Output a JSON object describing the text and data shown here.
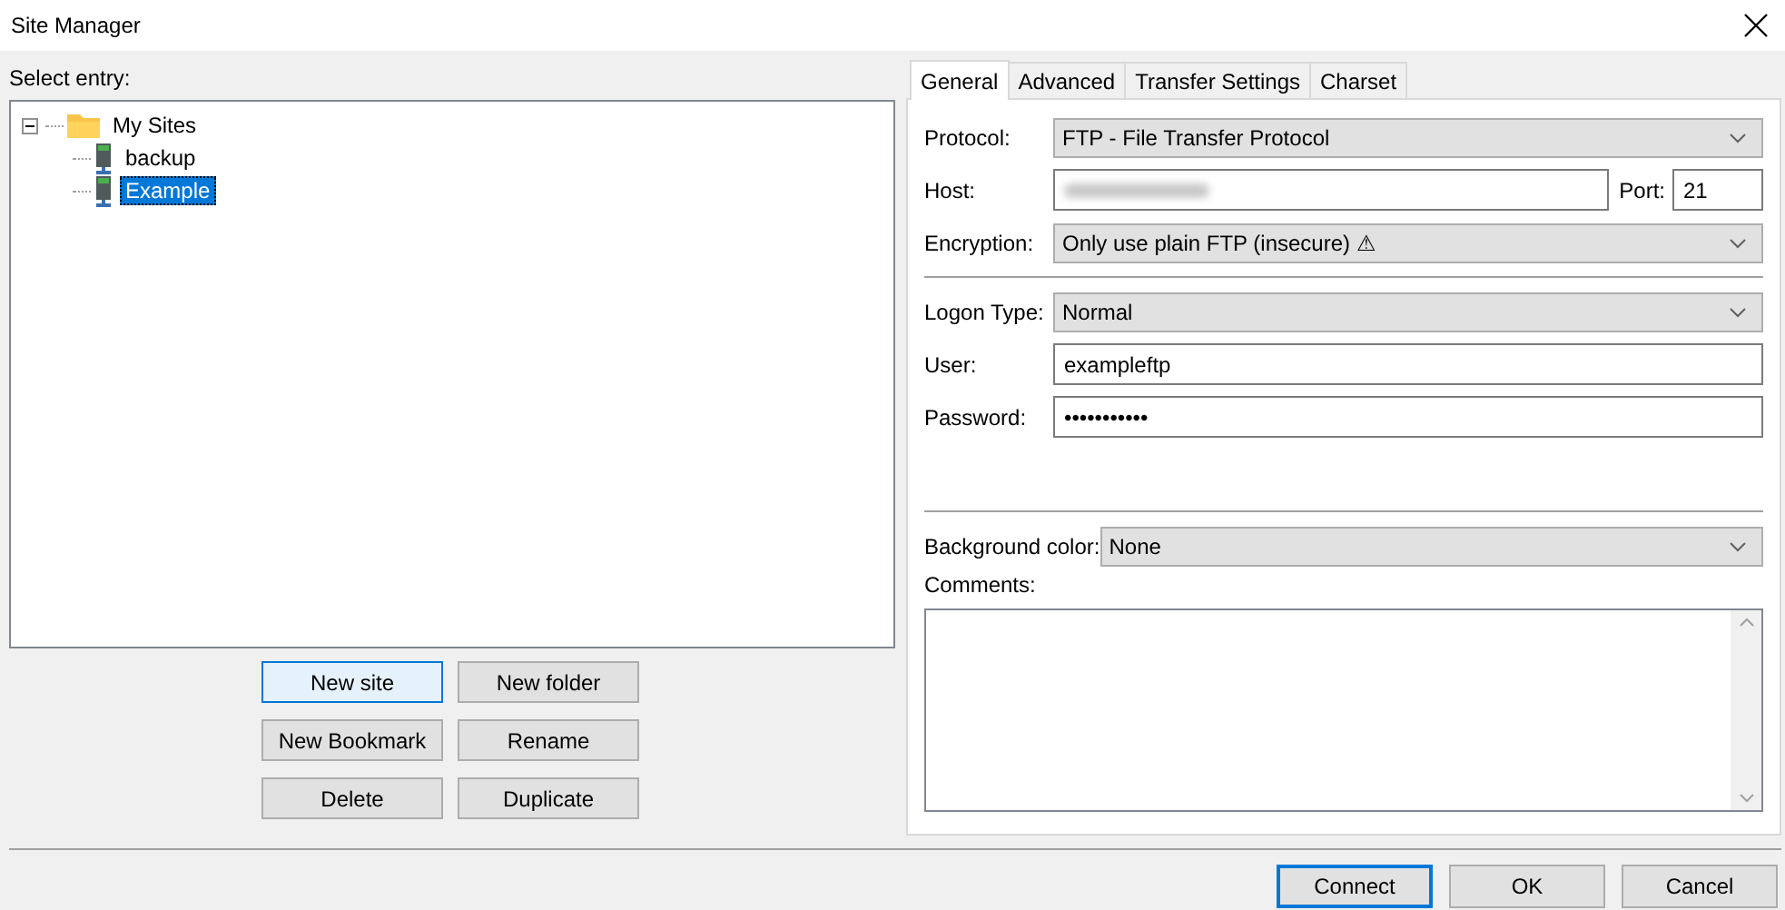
{
  "window": {
    "title": "Site Manager"
  },
  "select_entry": {
    "label": "Select entry:"
  },
  "tree": [
    {
      "label": "My Sites",
      "kind": "folder",
      "expanded": true,
      "selected": false,
      "children": [
        {
          "label": "backup",
          "kind": "site",
          "selected": false
        },
        {
          "label": "Example",
          "kind": "site",
          "selected": true
        }
      ]
    }
  ],
  "entry_buttons": [
    {
      "label": "New site",
      "focused": true
    },
    {
      "label": "New folder",
      "focused": false
    },
    {
      "label": "New Bookmark",
      "focused": false
    },
    {
      "label": "Rename",
      "focused": false
    },
    {
      "label": "Delete",
      "focused": false
    },
    {
      "label": "Duplicate",
      "focused": false
    }
  ],
  "tabs": [
    {
      "label": "General",
      "selected": true
    },
    {
      "label": "Advanced",
      "selected": false
    },
    {
      "label": "Transfer Settings",
      "selected": false
    },
    {
      "label": "Charset",
      "selected": false
    }
  ],
  "general": {
    "protocol": {
      "label": "Protocol:",
      "value": "FTP - File Transfer Protocol"
    },
    "host": {
      "label": "Host:",
      "redacted": true
    },
    "port": {
      "label": "Port:",
      "value": "21"
    },
    "encryption": {
      "label": "Encryption:",
      "value": "Only use plain FTP (insecure) ⚠"
    },
    "logon_type": {
      "label": "Logon Type:",
      "value": "Normal"
    },
    "user": {
      "label": "User:",
      "value": "exampleftp"
    },
    "password": {
      "label": "Password:",
      "value": "•••••••••••"
    },
    "background_color": {
      "label": "Background color:",
      "value": "None"
    },
    "comments": {
      "label": "Comments:"
    }
  },
  "dialog_buttons": [
    {
      "label": "Connect",
      "focused": true
    },
    {
      "label": "OK",
      "focused": false
    },
    {
      "label": "Cancel",
      "focused": false
    }
  ]
}
